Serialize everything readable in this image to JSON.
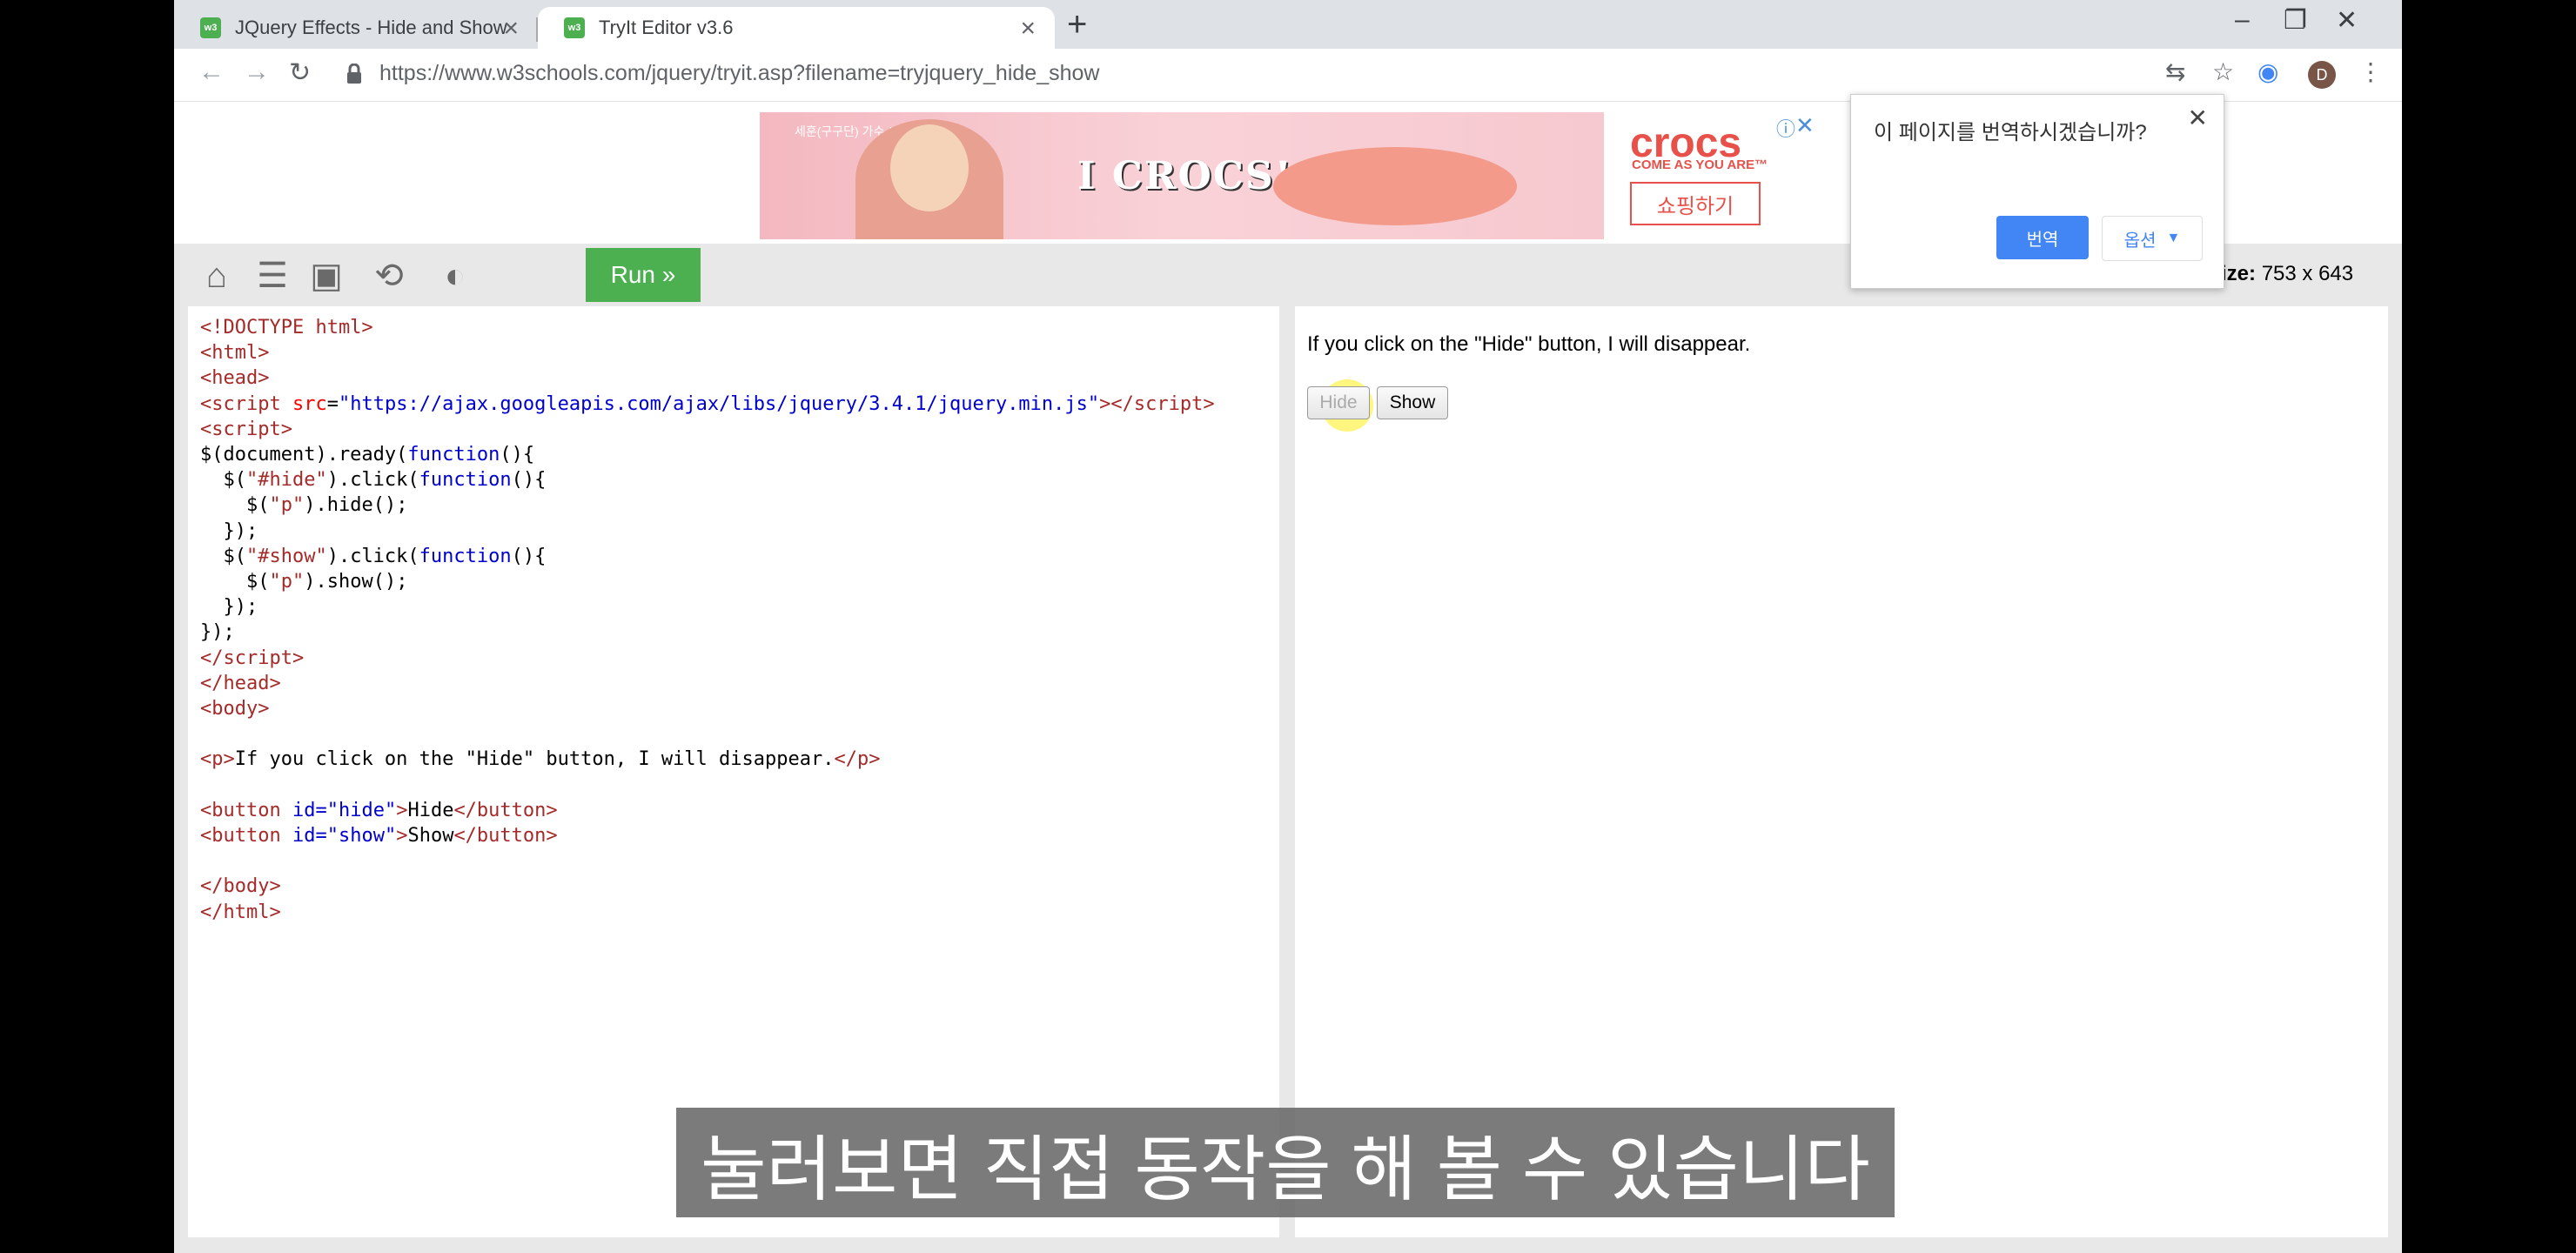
{
  "browser": {
    "tabs": [
      {
        "favicon": "w3",
        "title": "JQuery Effects - Hide and Show",
        "active": false
      },
      {
        "favicon": "w3",
        "title": "TryIt Editor v3.6",
        "active": true
      }
    ],
    "url": "https://www.w3schools.com/jquery/tryit.asp?filename=tryjquery_hide_show",
    "profile_initial": "D"
  },
  "ad": {
    "small_text": "세훈(구구단) 가수 / 배우",
    "slogan": "I CROCS!",
    "brand": "crocs",
    "tagline": "COME AS YOU ARE™",
    "cta": "쇼핑하기"
  },
  "editor": {
    "run_label": "Run »",
    "size_label": "ize:",
    "size_value": "753 x 643",
    "run_color": "#4caf50"
  },
  "code": {
    "url": "https://ajax.googleapis.com/ajax/libs/jquery/3.4.1/jquery.min.js",
    "paragraph": "If you click on the \"Hide\" button, I will disappear.",
    "hide_id": "\"hide\"",
    "show_id": "\"show\"",
    "hide_text": "Hide",
    "show_text": "Show"
  },
  "result": {
    "text": "If you click on the \"Hide\" button, I will disappear.",
    "hide_button": "Hide",
    "show_button": "Show"
  },
  "translate_popup": {
    "question": "이 페이지를 번역하시겠습니까?",
    "translate_button": "번역",
    "options_button": "옵션",
    "accent": "#4285f4"
  },
  "subtitle": "눌러보면 직접 동작을 해 볼 수 있습니다"
}
